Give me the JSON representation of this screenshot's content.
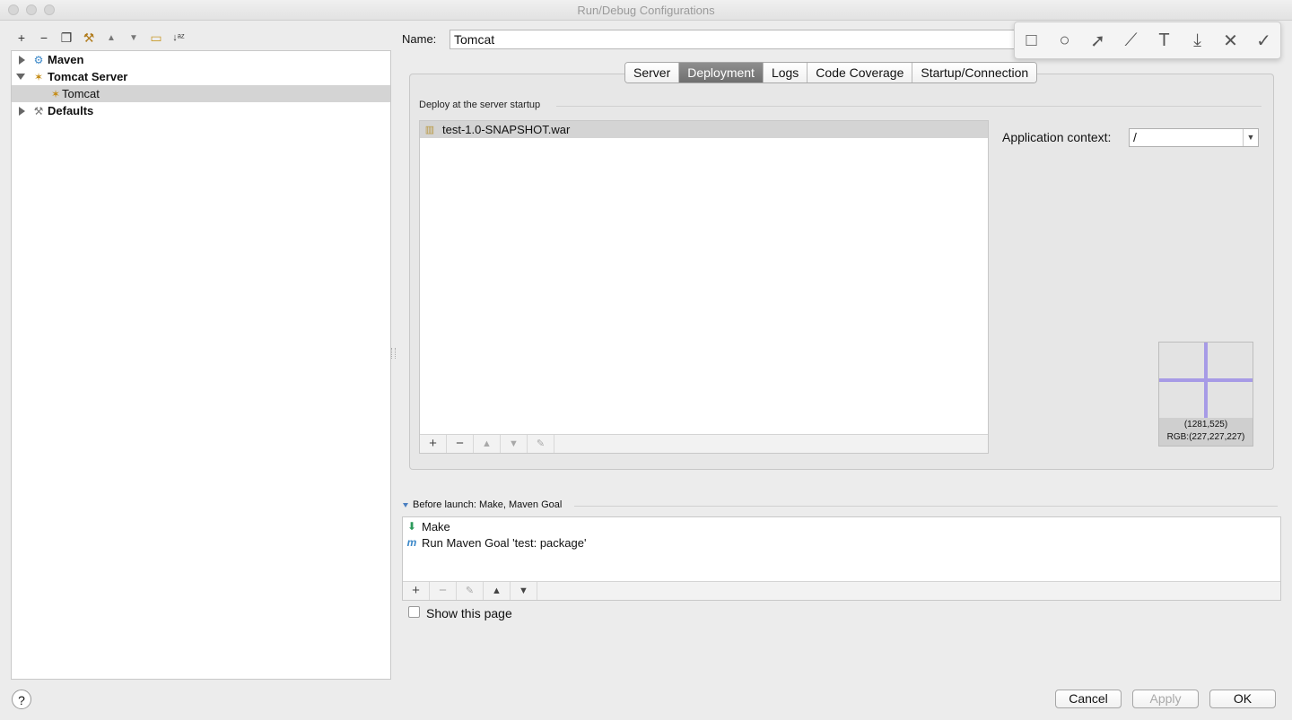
{
  "window": {
    "title": "Run/Debug Configurations"
  },
  "left_toolbar": {
    "buttons": [
      {
        "icon": "plus-icon",
        "glyph": "+"
      },
      {
        "icon": "minus-icon",
        "glyph": "−"
      },
      {
        "icon": "copy-icon",
        "glyph": "❐"
      },
      {
        "icon": "wrench-icon",
        "glyph": "⚒"
      },
      {
        "icon": "move-up-icon",
        "glyph": "▲"
      },
      {
        "icon": "move-down-icon",
        "glyph": "▼"
      },
      {
        "icon": "folder-icon",
        "glyph": "▭"
      },
      {
        "icon": "sort-icon",
        "glyph": "↓ᵃᶻ"
      }
    ]
  },
  "tree": {
    "items": [
      {
        "label": "Maven",
        "expanded": false,
        "icon": "maven-gear-icon"
      },
      {
        "label": "Tomcat Server",
        "expanded": true,
        "icon": "tomcat-icon"
      },
      {
        "label": "Tomcat",
        "selected": true,
        "icon": "tomcat-icon"
      },
      {
        "label": "Defaults",
        "expanded": false,
        "icon": "wrench-icon"
      }
    ]
  },
  "name_field": {
    "label": "Name:",
    "value": "Tomcat"
  },
  "screenshot_toolbar": {
    "tools": [
      "rectangle-icon",
      "circle-icon",
      "arrow-icon",
      "pen-icon",
      "text-icon",
      "download-icon",
      "close-icon",
      "check-icon"
    ],
    "glyphs": [
      "□",
      "○",
      "➚",
      "⟋",
      "T",
      "⤓",
      "✕",
      "✓"
    ]
  },
  "tabs": [
    {
      "label": "Server",
      "active": false
    },
    {
      "label": "Deployment",
      "active": true
    },
    {
      "label": "Logs",
      "active": false
    },
    {
      "label": "Code Coverage",
      "active": false
    },
    {
      "label": "Startup/Connection",
      "active": false
    }
  ],
  "deployment": {
    "section_title": "Deploy at the server startup",
    "artifacts": [
      "test-1.0-SNAPSHOT.war"
    ],
    "app_context_label": "Application context:",
    "app_context_value": "/"
  },
  "magnifier": {
    "coords": "(1281,525)",
    "rgb": "RGB:(227,227,227)",
    "accent": "#a79be6"
  },
  "before_launch": {
    "title": "Before launch: Make, Maven Goal",
    "tasks": [
      {
        "label": "Make",
        "icon": "make-icon"
      },
      {
        "label": "Run Maven Goal 'test: package'",
        "icon": "maven-icon"
      }
    ]
  },
  "show_page": {
    "label": "Show this page",
    "checked": false
  },
  "buttons": {
    "cancel": "Cancel",
    "apply": "Apply",
    "ok": "OK",
    "help": "?"
  }
}
